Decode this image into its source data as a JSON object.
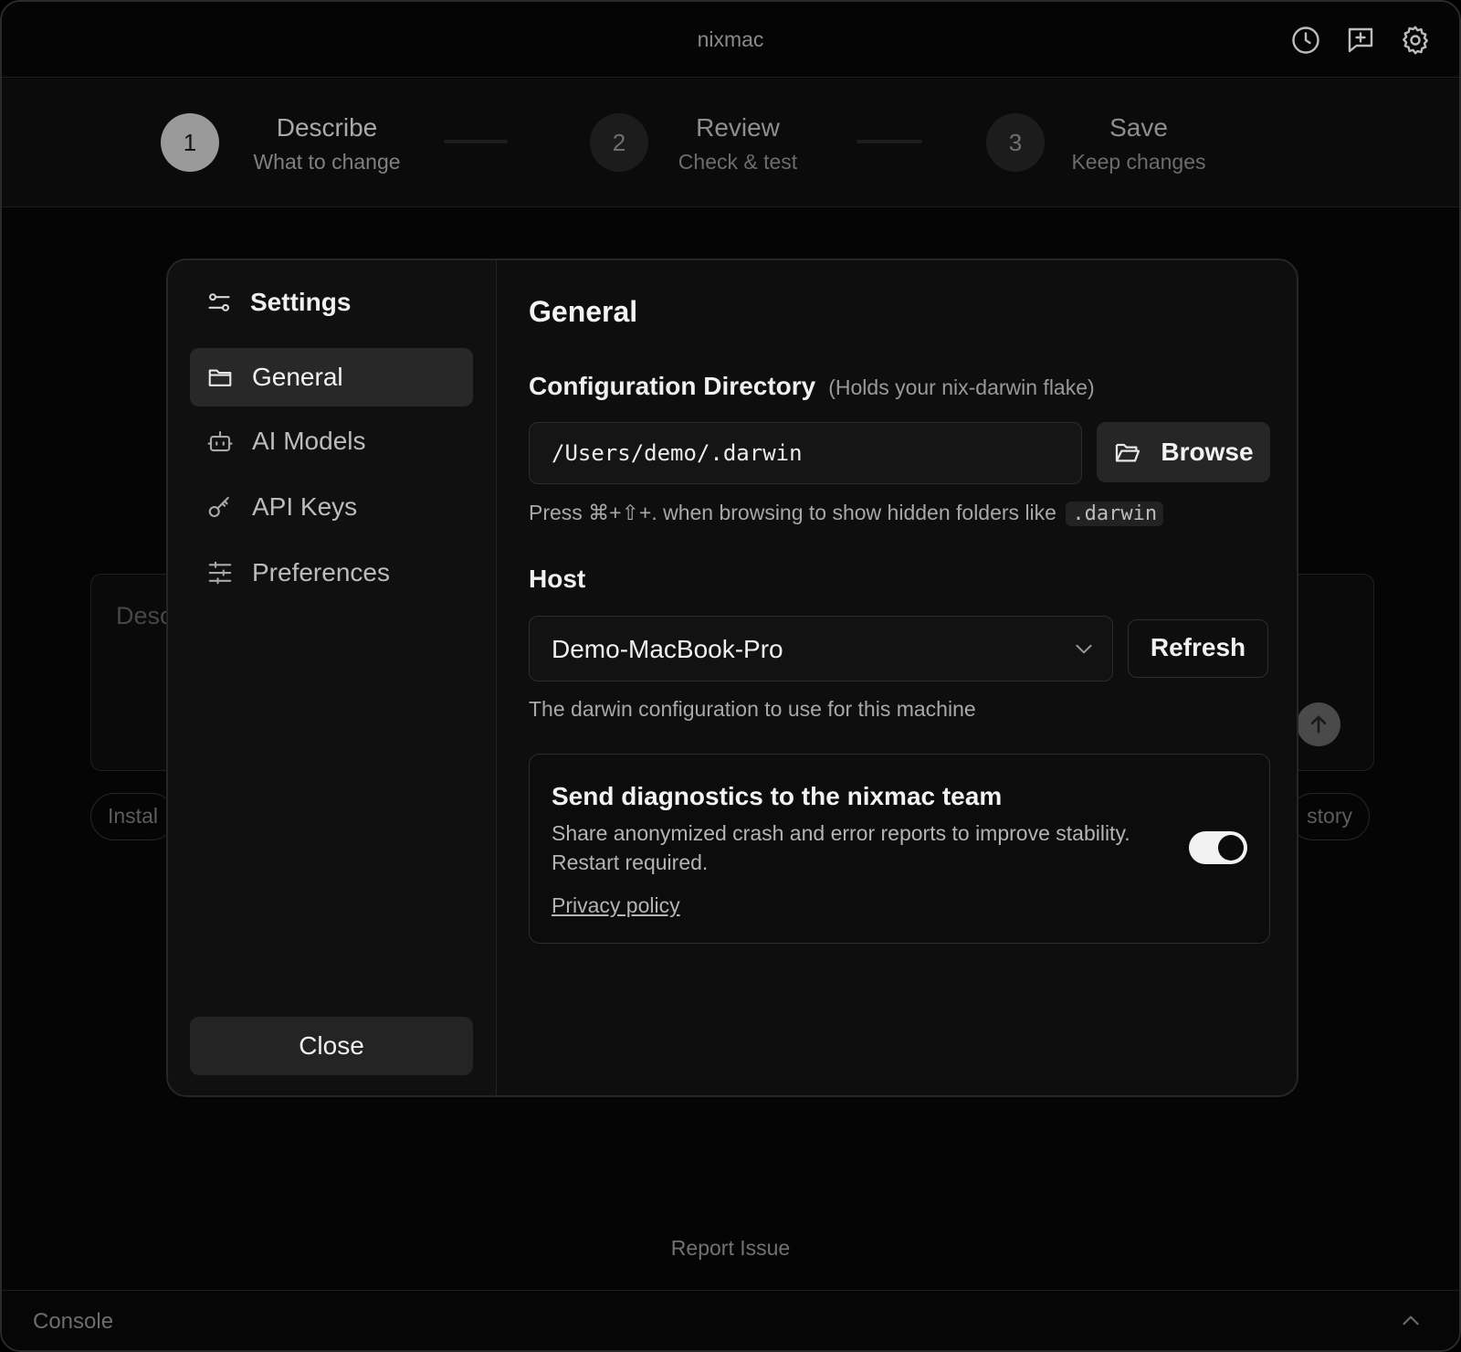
{
  "app": {
    "title": "nixmac"
  },
  "titlebar": {
    "icons": [
      "history-icon",
      "new-chat-icon",
      "gear-icon"
    ]
  },
  "stepper": {
    "steps": [
      {
        "num": "1",
        "title": "Describe",
        "subtitle": "What to change",
        "active": true
      },
      {
        "num": "2",
        "title": "Review",
        "subtitle": "Check & test",
        "active": false
      },
      {
        "num": "3",
        "title": "Save",
        "subtitle": "Keep changes",
        "active": false
      }
    ]
  },
  "background": {
    "prompt_placeholder": "Desc",
    "chip_left": "Instal",
    "chip_right": "story",
    "report_issue": "Report Issue",
    "console_label": "Console"
  },
  "settings": {
    "title": "Settings",
    "nav": [
      {
        "label": "General",
        "icon": "folder-icon",
        "active": true
      },
      {
        "label": "AI Models",
        "icon": "robot-icon",
        "active": false
      },
      {
        "label": "API Keys",
        "icon": "key-icon",
        "active": false
      },
      {
        "label": "Preferences",
        "icon": "sliders-icon",
        "active": false
      }
    ],
    "close_label": "Close"
  },
  "general": {
    "title": "General",
    "config_dir": {
      "label": "Configuration Directory",
      "note": "(Holds your nix-darwin flake)",
      "value": "/Users/demo/.darwin",
      "browse_label": "Browse",
      "hint_prefix": "Press ⌘+⇧+. when browsing to show hidden folders like",
      "hint_code": ".darwin"
    },
    "host": {
      "label": "Host",
      "value": "Demo-MacBook-Pro",
      "refresh_label": "Refresh",
      "hint": "The darwin configuration to use for this machine"
    },
    "diagnostics": {
      "title": "Send diagnostics to the nixmac team",
      "description": "Share anonymized crash and error reports to improve stability. Restart required.",
      "link": "Privacy policy",
      "enabled": true
    }
  },
  "colors": {
    "accent_toggle": "#f2f2f2",
    "background": "#050505",
    "modal_bg": "#0e0e0e"
  }
}
